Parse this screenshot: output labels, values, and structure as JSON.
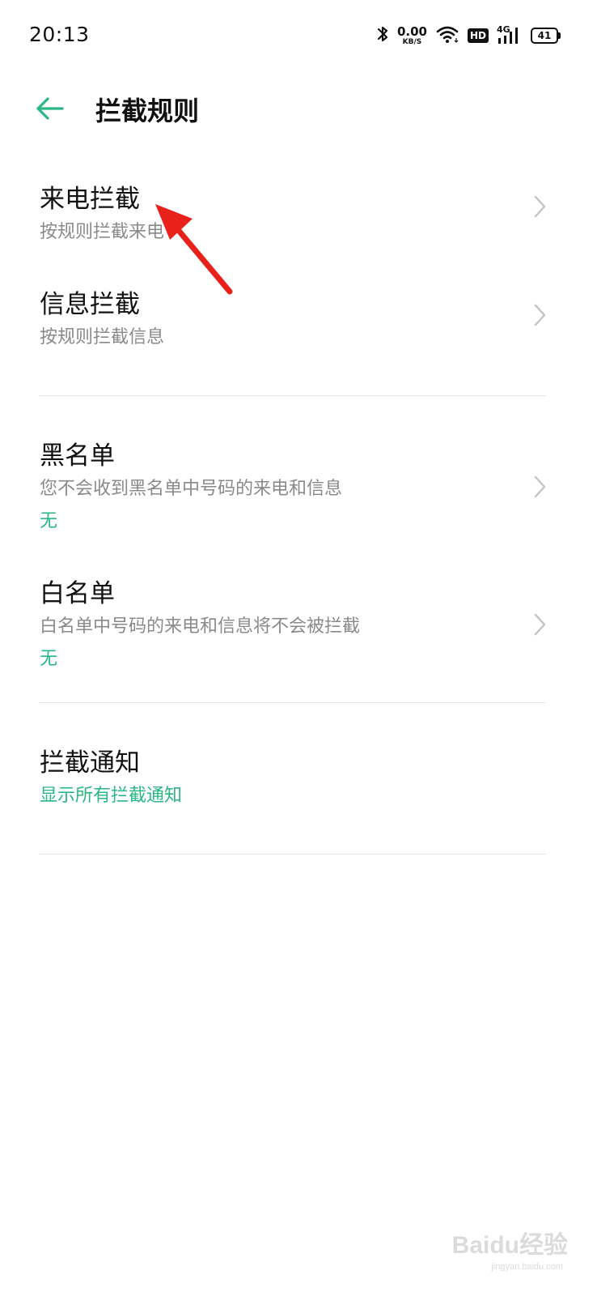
{
  "status_bar": {
    "time": "20:13",
    "net_speed_value": "0.00",
    "net_speed_unit": "KB/S",
    "hd_label": "HD",
    "network_label": "4G",
    "battery_level": "41",
    "icons": [
      "bluetooth-icon",
      "wifi-icon",
      "hd-icon",
      "signal-icon",
      "battery-icon"
    ]
  },
  "app_bar": {
    "title": "拦截规则",
    "back_icon": "arrow-left-icon"
  },
  "sections": [
    {
      "items": [
        {
          "title": "来电拦截",
          "summary": "按规则拦截来电"
        },
        {
          "title": "信息拦截",
          "summary": "按规则拦截信息"
        }
      ]
    },
    {
      "items": [
        {
          "title": "黑名单",
          "summary": "您不会收到黑名单中号码的来电和信息",
          "status": "无"
        },
        {
          "title": "白名单",
          "summary": "白名单中号码的来电和信息将不会被拦截",
          "status": "无"
        }
      ]
    },
    {
      "items": [
        {
          "title": "拦截通知",
          "status": "显示所有拦截通知"
        }
      ]
    }
  ],
  "watermark": {
    "text": "Baidu经验",
    "sub": "jingyan.baidu.com"
  },
  "colors": {
    "accent": "#2ab784",
    "annotation": "#e8221b",
    "summary": "#8a8a8a",
    "divider": "#e6e6e6"
  }
}
